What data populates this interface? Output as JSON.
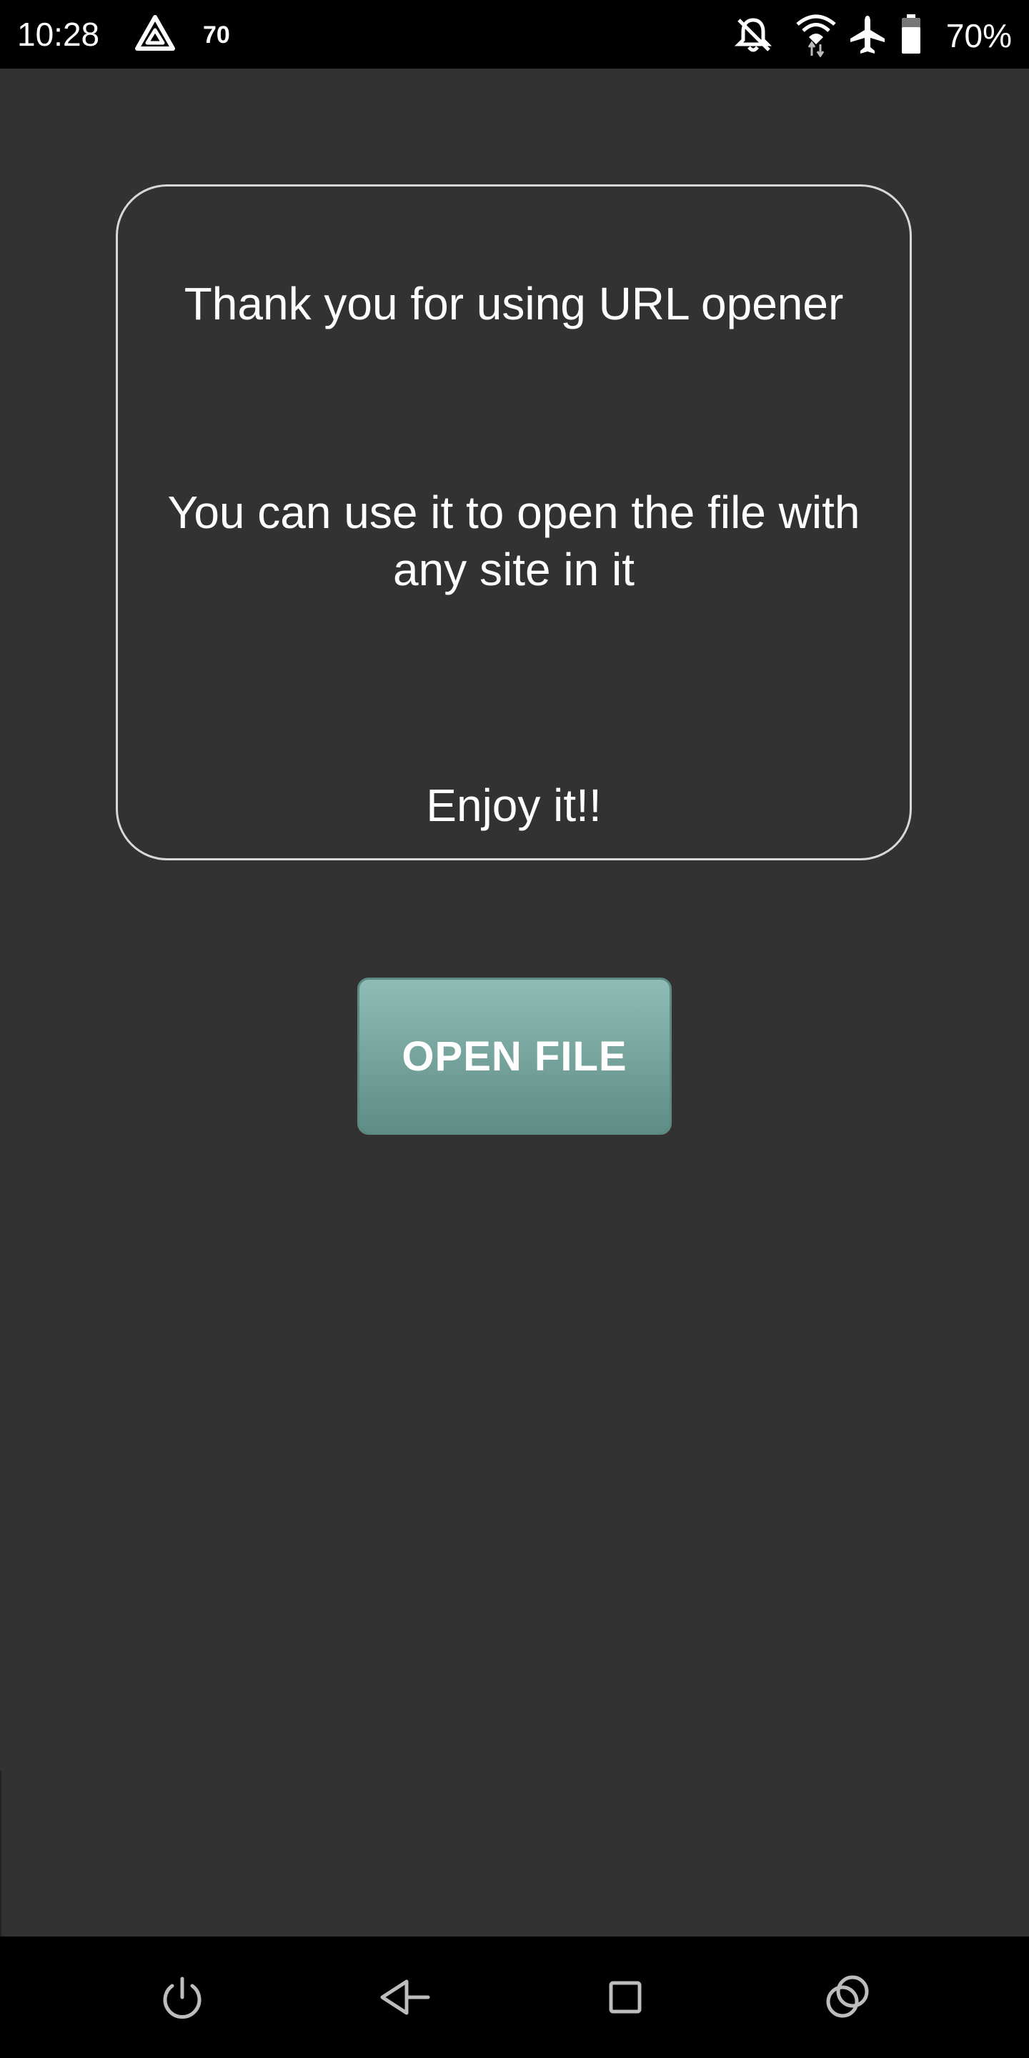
{
  "status_bar": {
    "time": "10:28",
    "notification_count": "70",
    "battery": "70%",
    "icons": [
      "app-triangle-icon",
      "notifications-off-icon",
      "wifi-icon",
      "airplane-mode-icon",
      "battery-icon"
    ]
  },
  "card": {
    "line1": "Thank you for using URL opener",
    "line2": "You can use it to open the file with any site in it",
    "line3": "Enjoy it!!"
  },
  "open_button": {
    "label": "OPEN FILE"
  },
  "nav_bar": {
    "icons": [
      "power-icon",
      "back-icon",
      "recents-icon",
      "assistant-icon"
    ]
  },
  "colors": {
    "background": "#333233",
    "bar": "#000000",
    "button": "#6e9e96",
    "card_border": "#d8d8d8"
  }
}
